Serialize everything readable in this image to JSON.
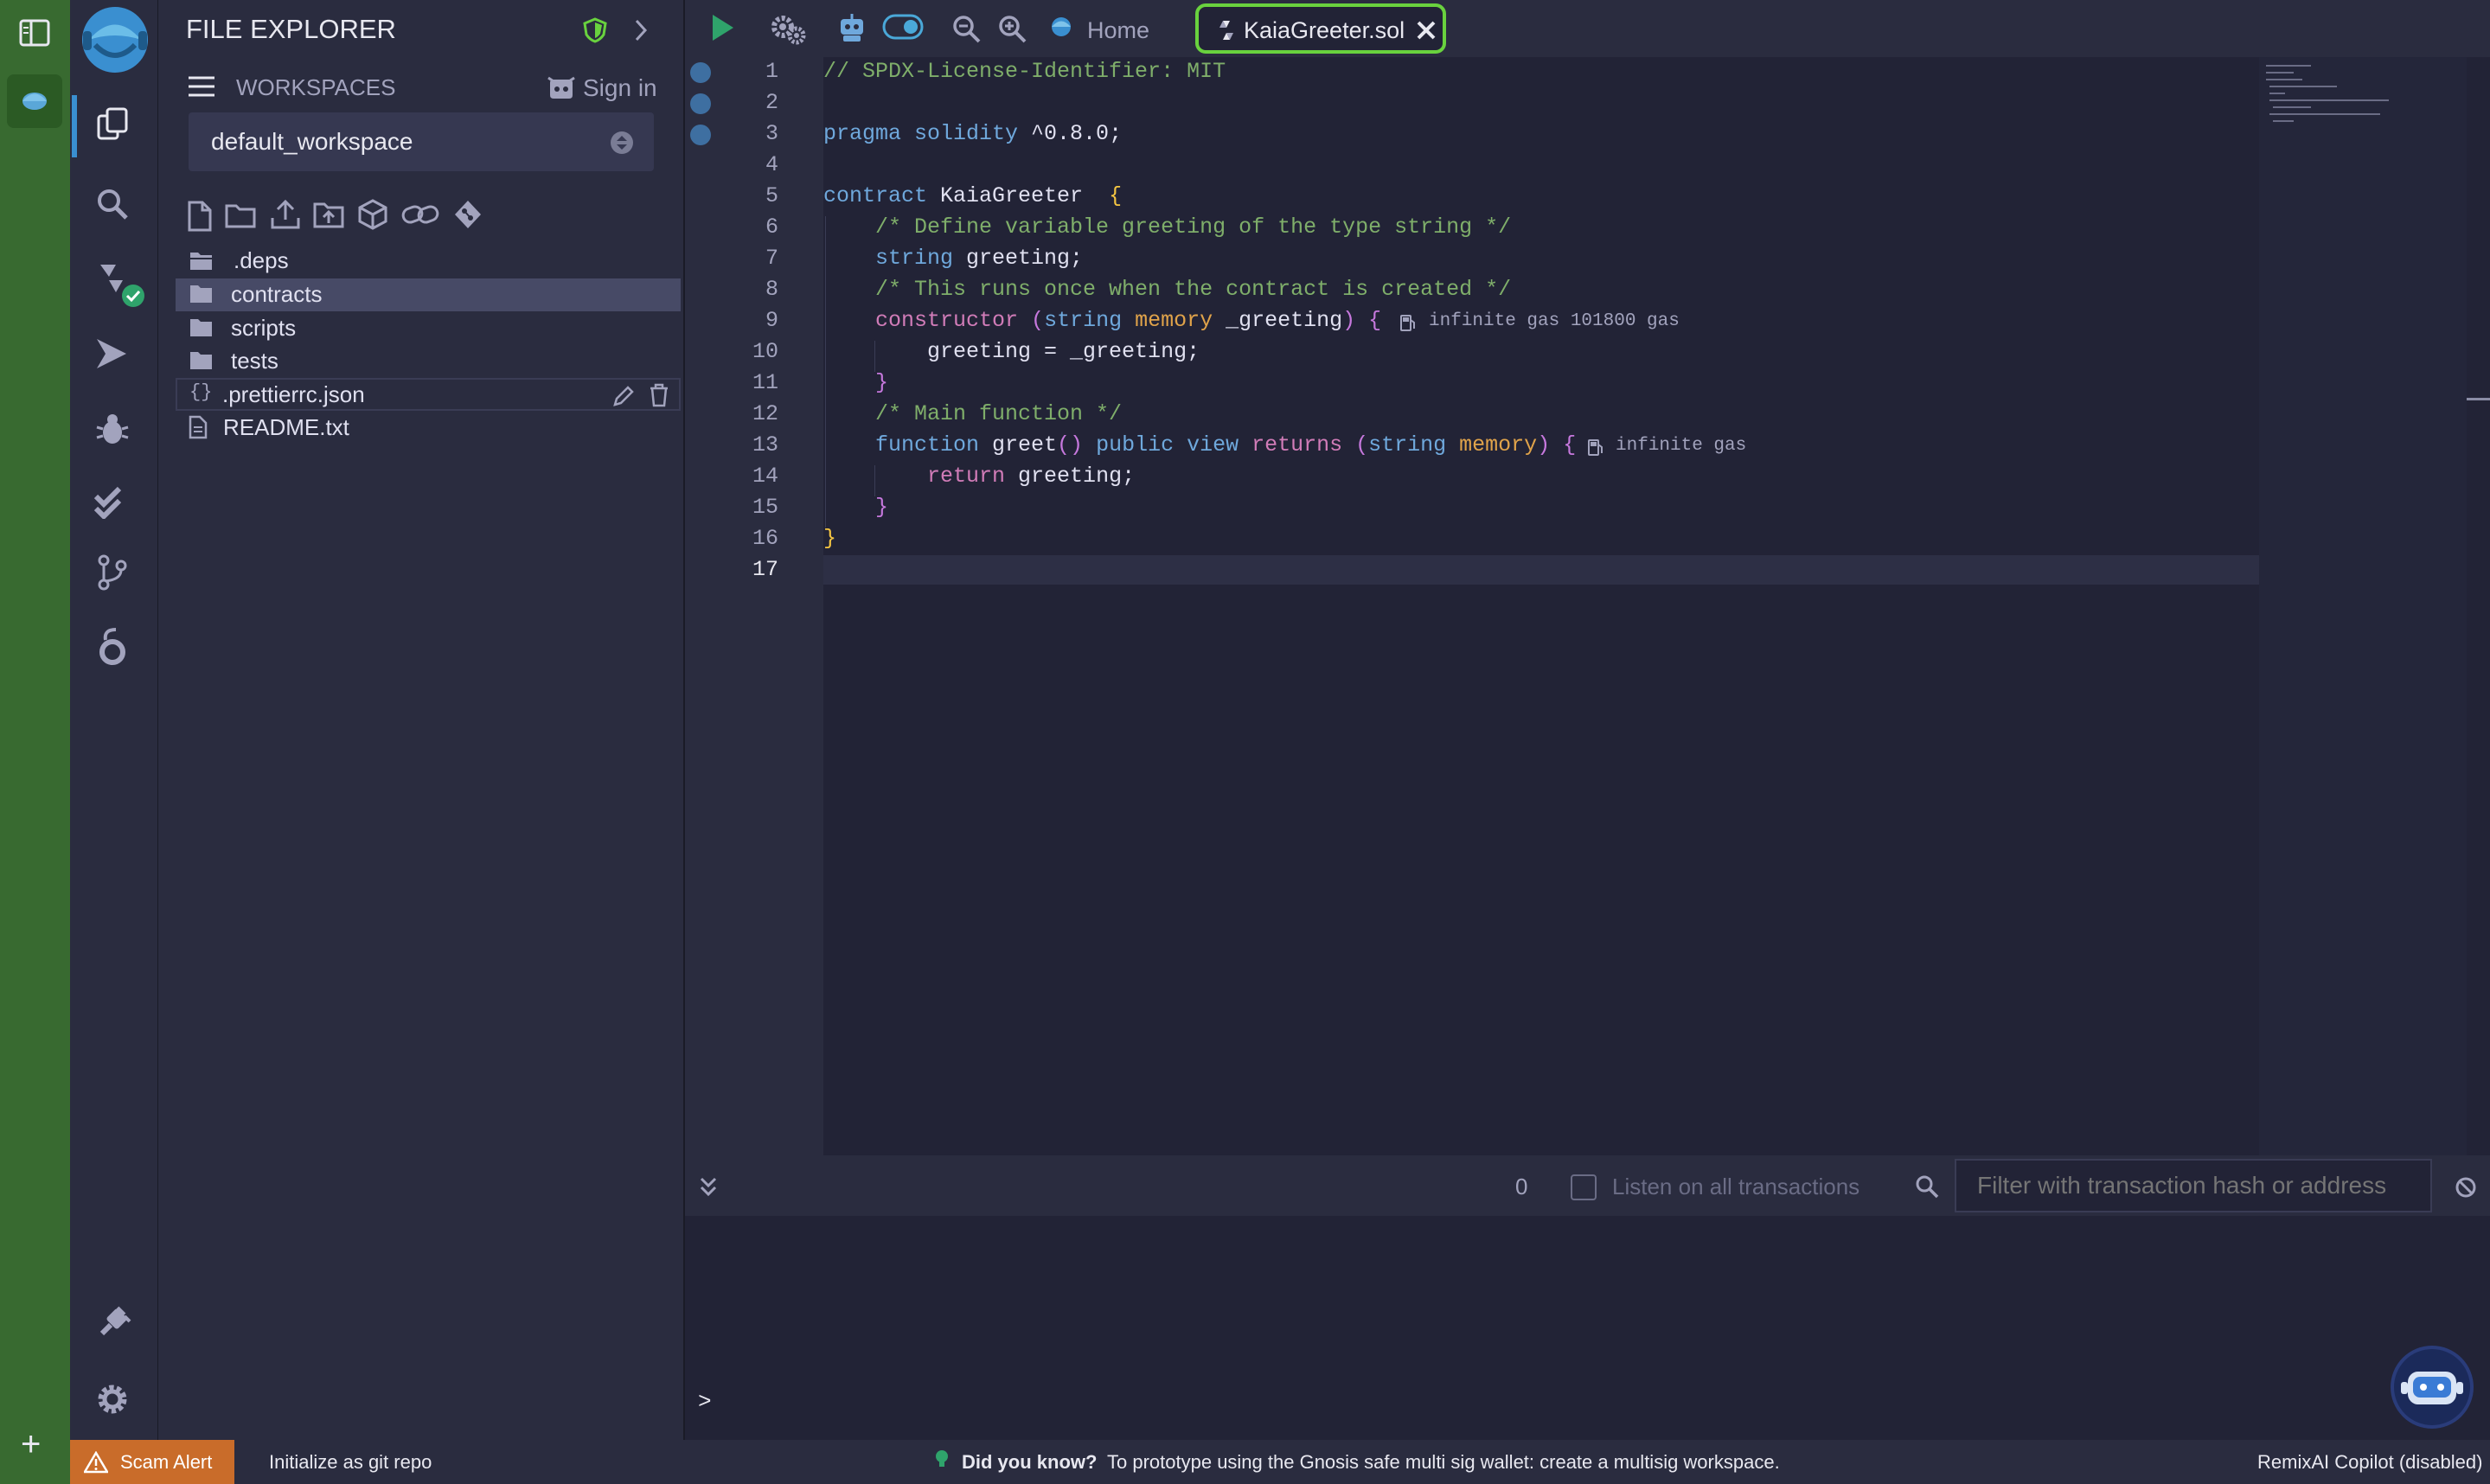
{
  "explorer": {
    "title": "FILE EXPLORER",
    "workspaces_label": "WORKSPACES",
    "sign_in": "Sign in",
    "workspace_selected": "default_workspace",
    "tree": [
      {
        "label": ".deps",
        "type": "folder"
      },
      {
        "label": "contracts",
        "type": "folder"
      },
      {
        "label": "scripts",
        "type": "folder"
      },
      {
        "label": "tests",
        "type": "folder"
      },
      {
        "label": ".prettierrc.json",
        "type": "json"
      },
      {
        "label": "README.txt",
        "type": "file"
      }
    ]
  },
  "tabs": {
    "home": "Home",
    "active": "KaiaGreeter.sol"
  },
  "editor": {
    "line_numbers": [
      "1",
      "2",
      "3",
      "4",
      "5",
      "6",
      "7",
      "8",
      "9",
      "10",
      "11",
      "12",
      "13",
      "14",
      "15",
      "16",
      "17"
    ],
    "lines": {
      "l1": "// SPDX-License-Identifier: MIT",
      "l3a": "pragma solidity",
      "l3b": " ^0.8.0;",
      "l5a": "contract",
      "l5b": " KaiaGreeter  ",
      "l5c": "{",
      "l6": "    /* Define variable greeting of the type string */",
      "l7a": "    string",
      "l7b": " greeting;",
      "l8": "    /* This runs once when the contract is created */",
      "l9a": "    constructor",
      "l9b": " (",
      "l9c": "string",
      "l9d": " memory",
      "l9e": " _greeting",
      "l9f": ") {",
      "l9gas": "infinite gas 101800 gas",
      "l10": "        greeting = _greeting;",
      "l11": "    }",
      "l12": "    /* Main function */",
      "l13a": "    function",
      "l13b": " greet",
      "l13c": "()",
      "l13d": " public",
      "l13e": " view",
      "l13f": " returns",
      "l13g": " (",
      "l13h": "string",
      "l13i": " memory",
      "l13j": ") {",
      "l13gas": "infinite gas",
      "l14a": "        return",
      "l14b": " greeting;",
      "l15": "    }",
      "l16": "}"
    }
  },
  "terminal": {
    "count": "0",
    "listen_label": "Listen on all transactions",
    "filter_placeholder": "Filter with transaction hash or address",
    "prompt": ">"
  },
  "status": {
    "scam_alert": "Scam Alert",
    "git_init": "Initialize as git repo",
    "did_you_know": "Did you know?",
    "tip": "To prototype using the Gnosis safe multi sig wallet: create a multisig workspace.",
    "copilot": "RemixAI Copilot (disabled)"
  },
  "colors": {
    "accent_green": "#69d23e",
    "strip_green": "#386a30",
    "status_orange": "#c96c2a"
  }
}
